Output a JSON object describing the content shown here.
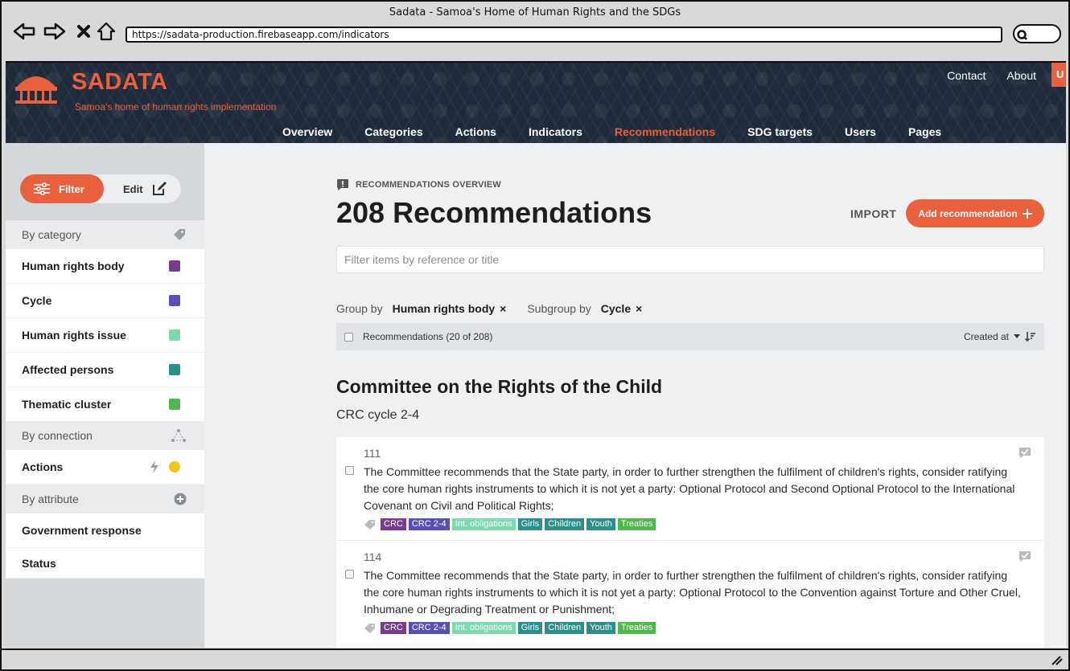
{
  "browser": {
    "window_title": "Sadata - Samoa's Home of Human Rights and the SDGs",
    "url": "https://sadata-production.firebaseapp.com/indicators"
  },
  "header": {
    "logo_title": "SADATA",
    "logo_subtitle": "Samoa's home of human rights implementation",
    "top_links": [
      "Contact",
      "About"
    ],
    "user_tab": "U",
    "nav": [
      "Overview",
      "Categories",
      "Actions",
      "Indicators",
      "Recommendations",
      "SDG targets",
      "Users",
      "Pages"
    ],
    "active_nav": "Recommendations"
  },
  "sidebar": {
    "filter_label": "Filter",
    "edit_label": "Edit",
    "by_category_label": "By category",
    "categories": [
      {
        "label": "Human rights body",
        "color": "#7a3b8f"
      },
      {
        "label": "Cycle",
        "color": "#5a4fb5"
      },
      {
        "label": "Human rights issue",
        "color": "#7ed8b0"
      },
      {
        "label": "Affected persons",
        "color": "#2a9089"
      },
      {
        "label": "Thematic cluster",
        "color": "#4fb84a"
      }
    ],
    "by_connection_label": "By connection",
    "connections": [
      {
        "label": "Actions",
        "icon": "lightning-icon",
        "dot_color": "#f5c518"
      }
    ],
    "by_attribute_label": "By attribute",
    "attributes": [
      "Government response",
      "Status"
    ]
  },
  "main": {
    "kicker": "RECOMMENDATIONS OVERVIEW",
    "title": "208 Recommendations",
    "import_label": "IMPORT",
    "add_label": "Add recommendation",
    "search_placeholder": "Filter items by reference or title",
    "group_by_label": "Group by",
    "group_by_value": "Human rights body",
    "subgroup_by_label": "Subgroup by",
    "subgroup_by_value": "Cycle",
    "list_count": "Recommendations (20 of 208)",
    "sort_label": "Created at",
    "group_title": "Committee on the Rights of the Child",
    "subgroup_title": "CRC cycle 2-4",
    "recommendations": [
      {
        "ref": "111",
        "text": "The Committee recommends that the State party, in order to further strengthen the fulfilment of children's rights, consider ratifying the core human rights instruments to which it is not yet a party: Optional Protocol and Second Optional Protocol to the International Covenant on Civil and Political Rights;",
        "tags": [
          {
            "label": "CRC",
            "color": "#7a3b8f"
          },
          {
            "label": "CRC 2-4",
            "color": "#5a4fb5"
          },
          {
            "label": "Int. obligations",
            "color": "#7ed8b0"
          },
          {
            "label": "Girls",
            "color": "#2a9089"
          },
          {
            "label": "Children",
            "color": "#2a9089"
          },
          {
            "label": "Youth",
            "color": "#2a9089"
          },
          {
            "label": "Treaties",
            "color": "#4fb84a"
          }
        ]
      },
      {
        "ref": "114",
        "text": "The Committee recommends that the State party, in order to further strengthen the fulfilment of children's rights, consider ratifying the core human rights instruments to which it is not yet a party: Optional Protocol to the Convention against Torture and Other Cruel, Inhumane or Degrading Treatment or Punishment;",
        "tags": [
          {
            "label": "CRC",
            "color": "#7a3b8f"
          },
          {
            "label": "CRC 2-4",
            "color": "#5a4fb5"
          },
          {
            "label": "Int. obligations",
            "color": "#7ed8b0"
          },
          {
            "label": "Girls",
            "color": "#2a9089"
          },
          {
            "label": "Children",
            "color": "#2a9089"
          },
          {
            "label": "Youth",
            "color": "#2a9089"
          },
          {
            "label": "Treaties",
            "color": "#4fb84a"
          }
        ]
      }
    ]
  },
  "colors": {
    "accent": "#e8603c",
    "header_bg": "#1f2b3a"
  }
}
